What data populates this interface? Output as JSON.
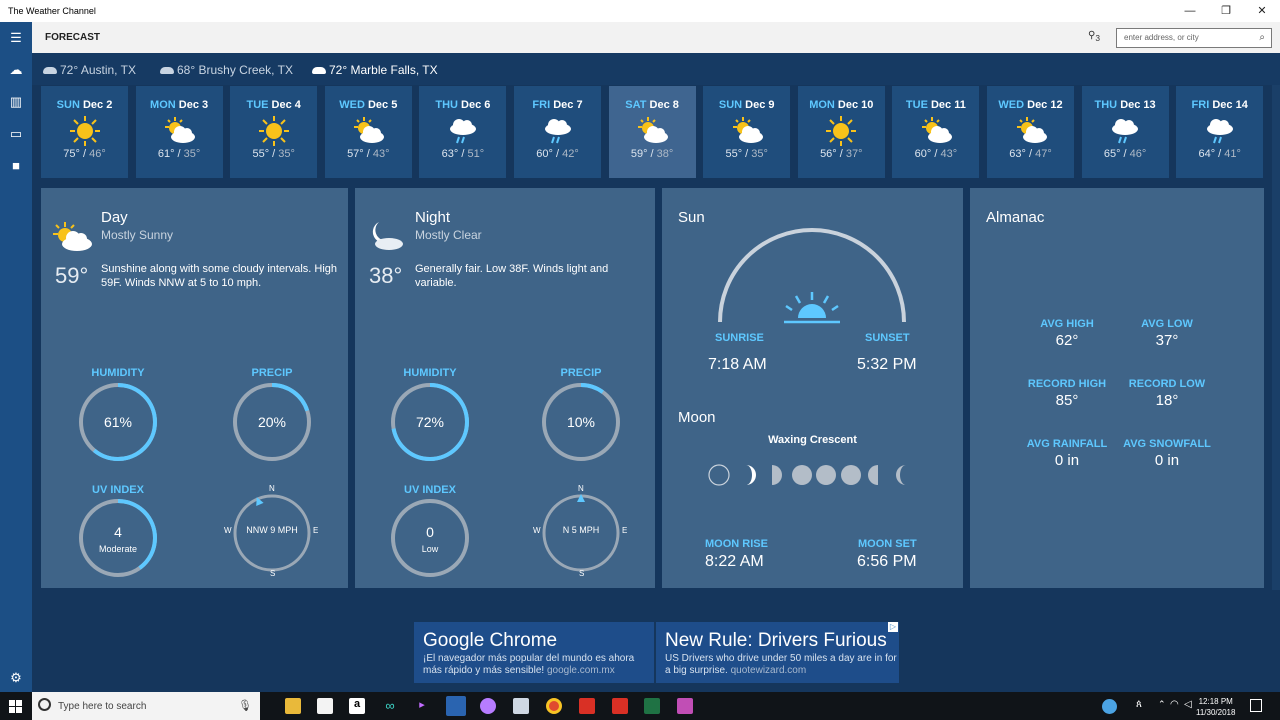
{
  "app": {
    "title": "The Weather Channel",
    "minimize": "—",
    "maximize": "❐",
    "close": "✕"
  },
  "header": {
    "title": "FORECAST",
    "location_icon": "location-pin-icon",
    "location_count": "3",
    "search_placeholder": "enter address, or city"
  },
  "sidebar": {
    "items": [
      "hamburger-menu-icon",
      "forecast-icon",
      "maps-icon",
      "news-icon",
      "video-icon"
    ],
    "settings": "gear-icon"
  },
  "locations": [
    {
      "label": "72° Austin, TX",
      "current": false
    },
    {
      "label": "68° Brushy Creek, TX",
      "current": false
    },
    {
      "label": "72° Marble Falls, TX",
      "current": true
    }
  ],
  "days": [
    {
      "weekday": "SUN",
      "date": "Dec 2",
      "icon": "sun",
      "high": "75°",
      "low": "46°"
    },
    {
      "weekday": "MON",
      "date": "Dec 3",
      "icon": "partly-cloudy",
      "high": "61°",
      "low": "35°"
    },
    {
      "weekday": "TUE",
      "date": "Dec 4",
      "icon": "sun",
      "high": "55°",
      "low": "35°"
    },
    {
      "weekday": "WED",
      "date": "Dec 5",
      "icon": "partly-cloudy",
      "high": "57°",
      "low": "43°"
    },
    {
      "weekday": "THU",
      "date": "Dec 6",
      "icon": "rain",
      "high": "63°",
      "low": "51°"
    },
    {
      "weekday": "FRI",
      "date": "Dec 7",
      "icon": "rain",
      "high": "60°",
      "low": "42°"
    },
    {
      "weekday": "SAT",
      "date": "Dec 8",
      "icon": "partly-cloudy",
      "high": "59°",
      "low": "38°"
    },
    {
      "weekday": "SUN",
      "date": "Dec 9",
      "icon": "partly-cloudy",
      "high": "55°",
      "low": "35°"
    },
    {
      "weekday": "MON",
      "date": "Dec 10",
      "icon": "sun",
      "high": "56°",
      "low": "37°"
    },
    {
      "weekday": "TUE",
      "date": "Dec 11",
      "icon": "partly-cloudy",
      "high": "60°",
      "low": "43°"
    },
    {
      "weekday": "WED",
      "date": "Dec 12",
      "icon": "partly-cloudy",
      "high": "63°",
      "low": "47°"
    },
    {
      "weekday": "THU",
      "date": "Dec 13",
      "icon": "rain",
      "high": "65°",
      "low": "46°"
    },
    {
      "weekday": "FRI",
      "date": "Dec 14",
      "icon": "rain",
      "high": "64°",
      "low": "41°"
    }
  ],
  "selected_day": 6,
  "day_panel": {
    "title": "Day",
    "condition": "Mostly Sunny",
    "temp": "59°",
    "description": "Sunshine along with some cloudy intervals. High 59F. Winds NNW at 5 to 10 mph.",
    "humidity_label": "HUMIDITY",
    "humidity": "61%",
    "humidity_fraction": 0.61,
    "precip_label": "PRECIP",
    "precip": "20%",
    "precip_fraction": 0.2,
    "uv_label": "UV INDEX",
    "uv": "4",
    "uv_text": "Moderate",
    "uv_fraction": 0.4,
    "wind": "NNW 9 MPH",
    "wind_deg": 337
  },
  "night_panel": {
    "title": "Night",
    "condition": "Mostly Clear",
    "temp": "38°",
    "description": "Generally fair. Low 38F. Winds light and variable.",
    "humidity_label": "HUMIDITY",
    "humidity": "72%",
    "humidity_fraction": 0.72,
    "precip_label": "PRECIP",
    "precip": "10%",
    "precip_fraction": 0.1,
    "uv_label": "UV INDEX",
    "uv": "0",
    "uv_text": "Low",
    "uv_fraction": 0,
    "wind": "N 5 MPH",
    "wind_deg": 0
  },
  "compass": {
    "n": "N",
    "e": "E",
    "s": "S",
    "w": "W"
  },
  "sun_panel": {
    "title": "Sun",
    "sunrise_label": "SUNRISE",
    "sunrise": "7:18 AM",
    "sunset_label": "SUNSET",
    "sunset": "5:32 PM",
    "moon_title": "Moon",
    "moon_phase": "Waxing Crescent",
    "moonrise_label": "MOON RISE",
    "moonrise": "8:22 AM",
    "moonset_label": "MOON SET",
    "moonset": "6:56 PM"
  },
  "almanac": {
    "title": "Almanac",
    "items": [
      {
        "label": "AVG HIGH",
        "value": "62°"
      },
      {
        "label": "AVG LOW",
        "value": "37°"
      },
      {
        "label": "RECORD HIGH",
        "value": "85°"
      },
      {
        "label": "RECORD LOW",
        "value": "18°"
      },
      {
        "label": "AVG RAINFALL",
        "value": "0 in"
      },
      {
        "label": "AVG SNOWFALL",
        "value": "0 in"
      }
    ]
  },
  "ads": [
    {
      "title": "Google Chrome",
      "body": "¡El navegador más popular del mundo es ahora más rápido y más sensible!",
      "url": "google.com.mx"
    },
    {
      "title": "New Rule: Drivers Furious",
      "body": "US Drivers who drive under 50 miles a day are in for a big surprise.",
      "url": "quotewizard.com"
    }
  ],
  "taskbar": {
    "search_placeholder": "Type here to search",
    "time": "12:18 PM",
    "date": "11/30/2018"
  },
  "colors": {
    "accent": "#5ec8ff",
    "panel": "#3f6488",
    "background": "#15365c"
  }
}
